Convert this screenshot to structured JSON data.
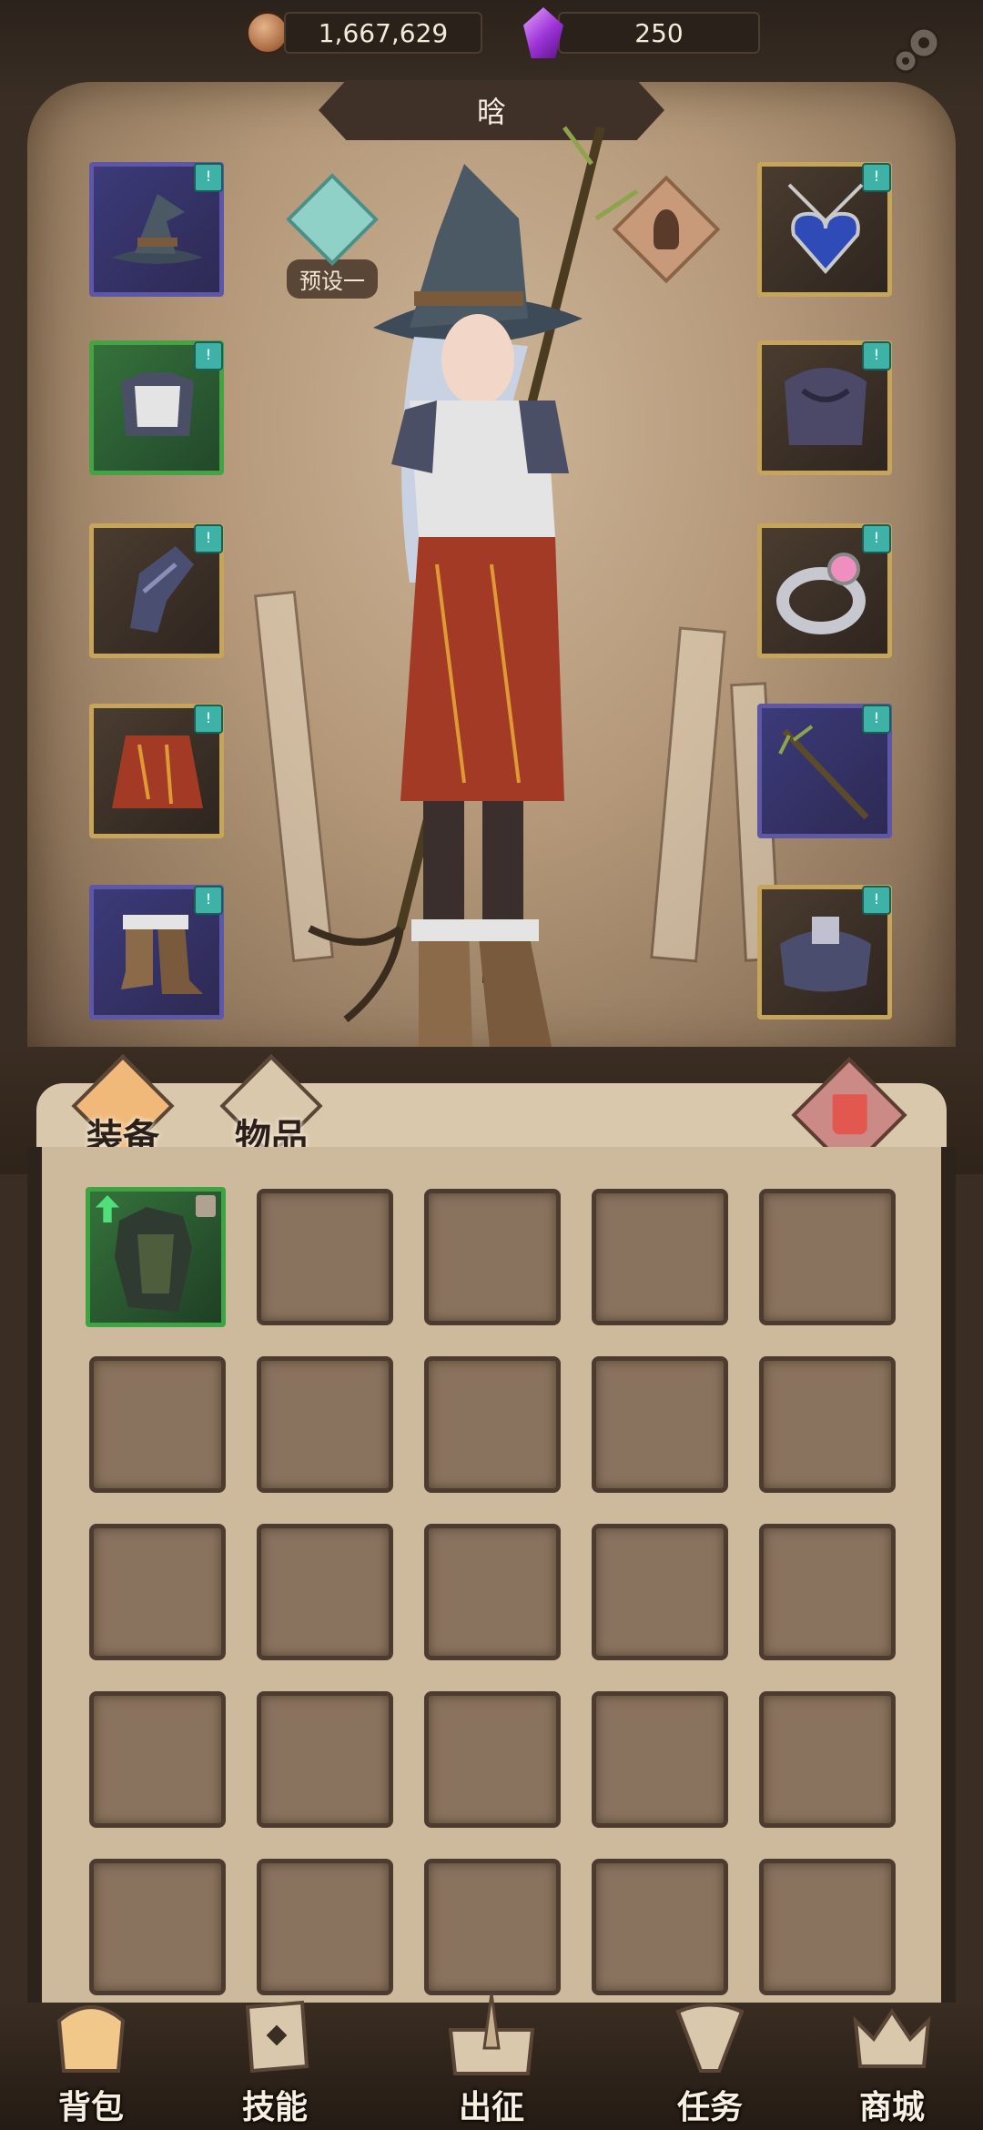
{
  "currency": {
    "coins": "1,667,629",
    "gems": "250"
  },
  "character": {
    "name": "晗",
    "preset_label": "预设一"
  },
  "equipment": {
    "left": [
      {
        "name": "witch-hat",
        "rarity": "purple",
        "badge": "!"
      },
      {
        "name": "armor-top",
        "rarity": "green",
        "badge": "!"
      },
      {
        "name": "gauntlets",
        "rarity": "gold",
        "badge": "!"
      },
      {
        "name": "skirt",
        "rarity": "gold",
        "badge": "!"
      },
      {
        "name": "boots",
        "rarity": "purple",
        "badge": "!"
      }
    ],
    "right": [
      {
        "name": "heart-necklace",
        "rarity": "gold",
        "badge": "!"
      },
      {
        "name": "cloak",
        "rarity": "gold",
        "badge": "!"
      },
      {
        "name": "ring",
        "rarity": "gold",
        "badge": "!"
      },
      {
        "name": "staff",
        "rarity": "purple",
        "badge": "!"
      },
      {
        "name": "belt",
        "rarity": "gold",
        "badge": "!"
      }
    ]
  },
  "tabs": {
    "equipment": "装备",
    "items": "物品"
  },
  "inventory": {
    "rows": 5,
    "cols": 5,
    "items": [
      {
        "slot": 0,
        "rarity": "green",
        "upgrade": true,
        "locked": true
      }
    ]
  },
  "nav": {
    "backpack": "背包",
    "skills": "技能",
    "expedition": "出征",
    "tasks": "任务",
    "shop": "商城"
  },
  "colors": {
    "rarity_green": "#46a345",
    "rarity_purple": "#5e56a6",
    "rarity_gold": "#c6a55a",
    "badge": "#3eb2a7"
  }
}
